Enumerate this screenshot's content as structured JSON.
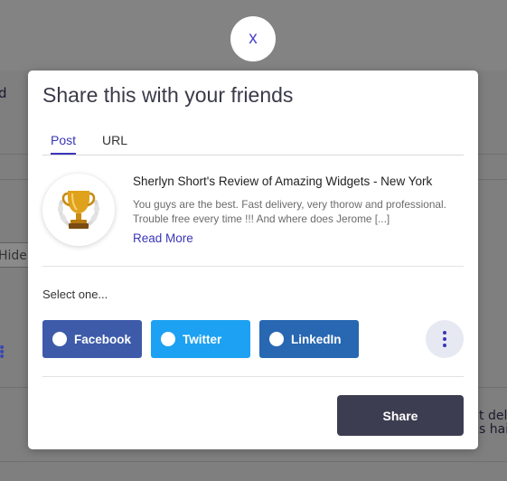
{
  "background": {
    "fragments": [
      "d",
      "Hide",
      "t del",
      "s hai"
    ]
  },
  "close": {
    "label": "x"
  },
  "modal": {
    "title": "Share this with your friends",
    "tabs": [
      {
        "label": "Post",
        "active": true
      },
      {
        "label": "URL",
        "active": false
      }
    ],
    "review": {
      "icon": "trophy-icon",
      "title": "Sherlyn Short's Review of Amazing Widgets - New York",
      "body": "You guys are the best. Fast delivery, very thorow and professional. Trouble free every time !!! And where does Jerome [...]",
      "read_more": "Read More"
    },
    "select_label": "Select one...",
    "options": [
      {
        "label": "Facebook",
        "color": "#3d5ba9"
      },
      {
        "label": "Twitter",
        "color": "#1da1f2"
      },
      {
        "label": "LinkedIn",
        "color": "#2867b2"
      }
    ],
    "more_icon": "kebab-menu-icon",
    "share_label": "Share"
  },
  "colors": {
    "accent": "#3b36b7",
    "share_button": "#3d3d52",
    "overlay": "#7f7f7f"
  }
}
